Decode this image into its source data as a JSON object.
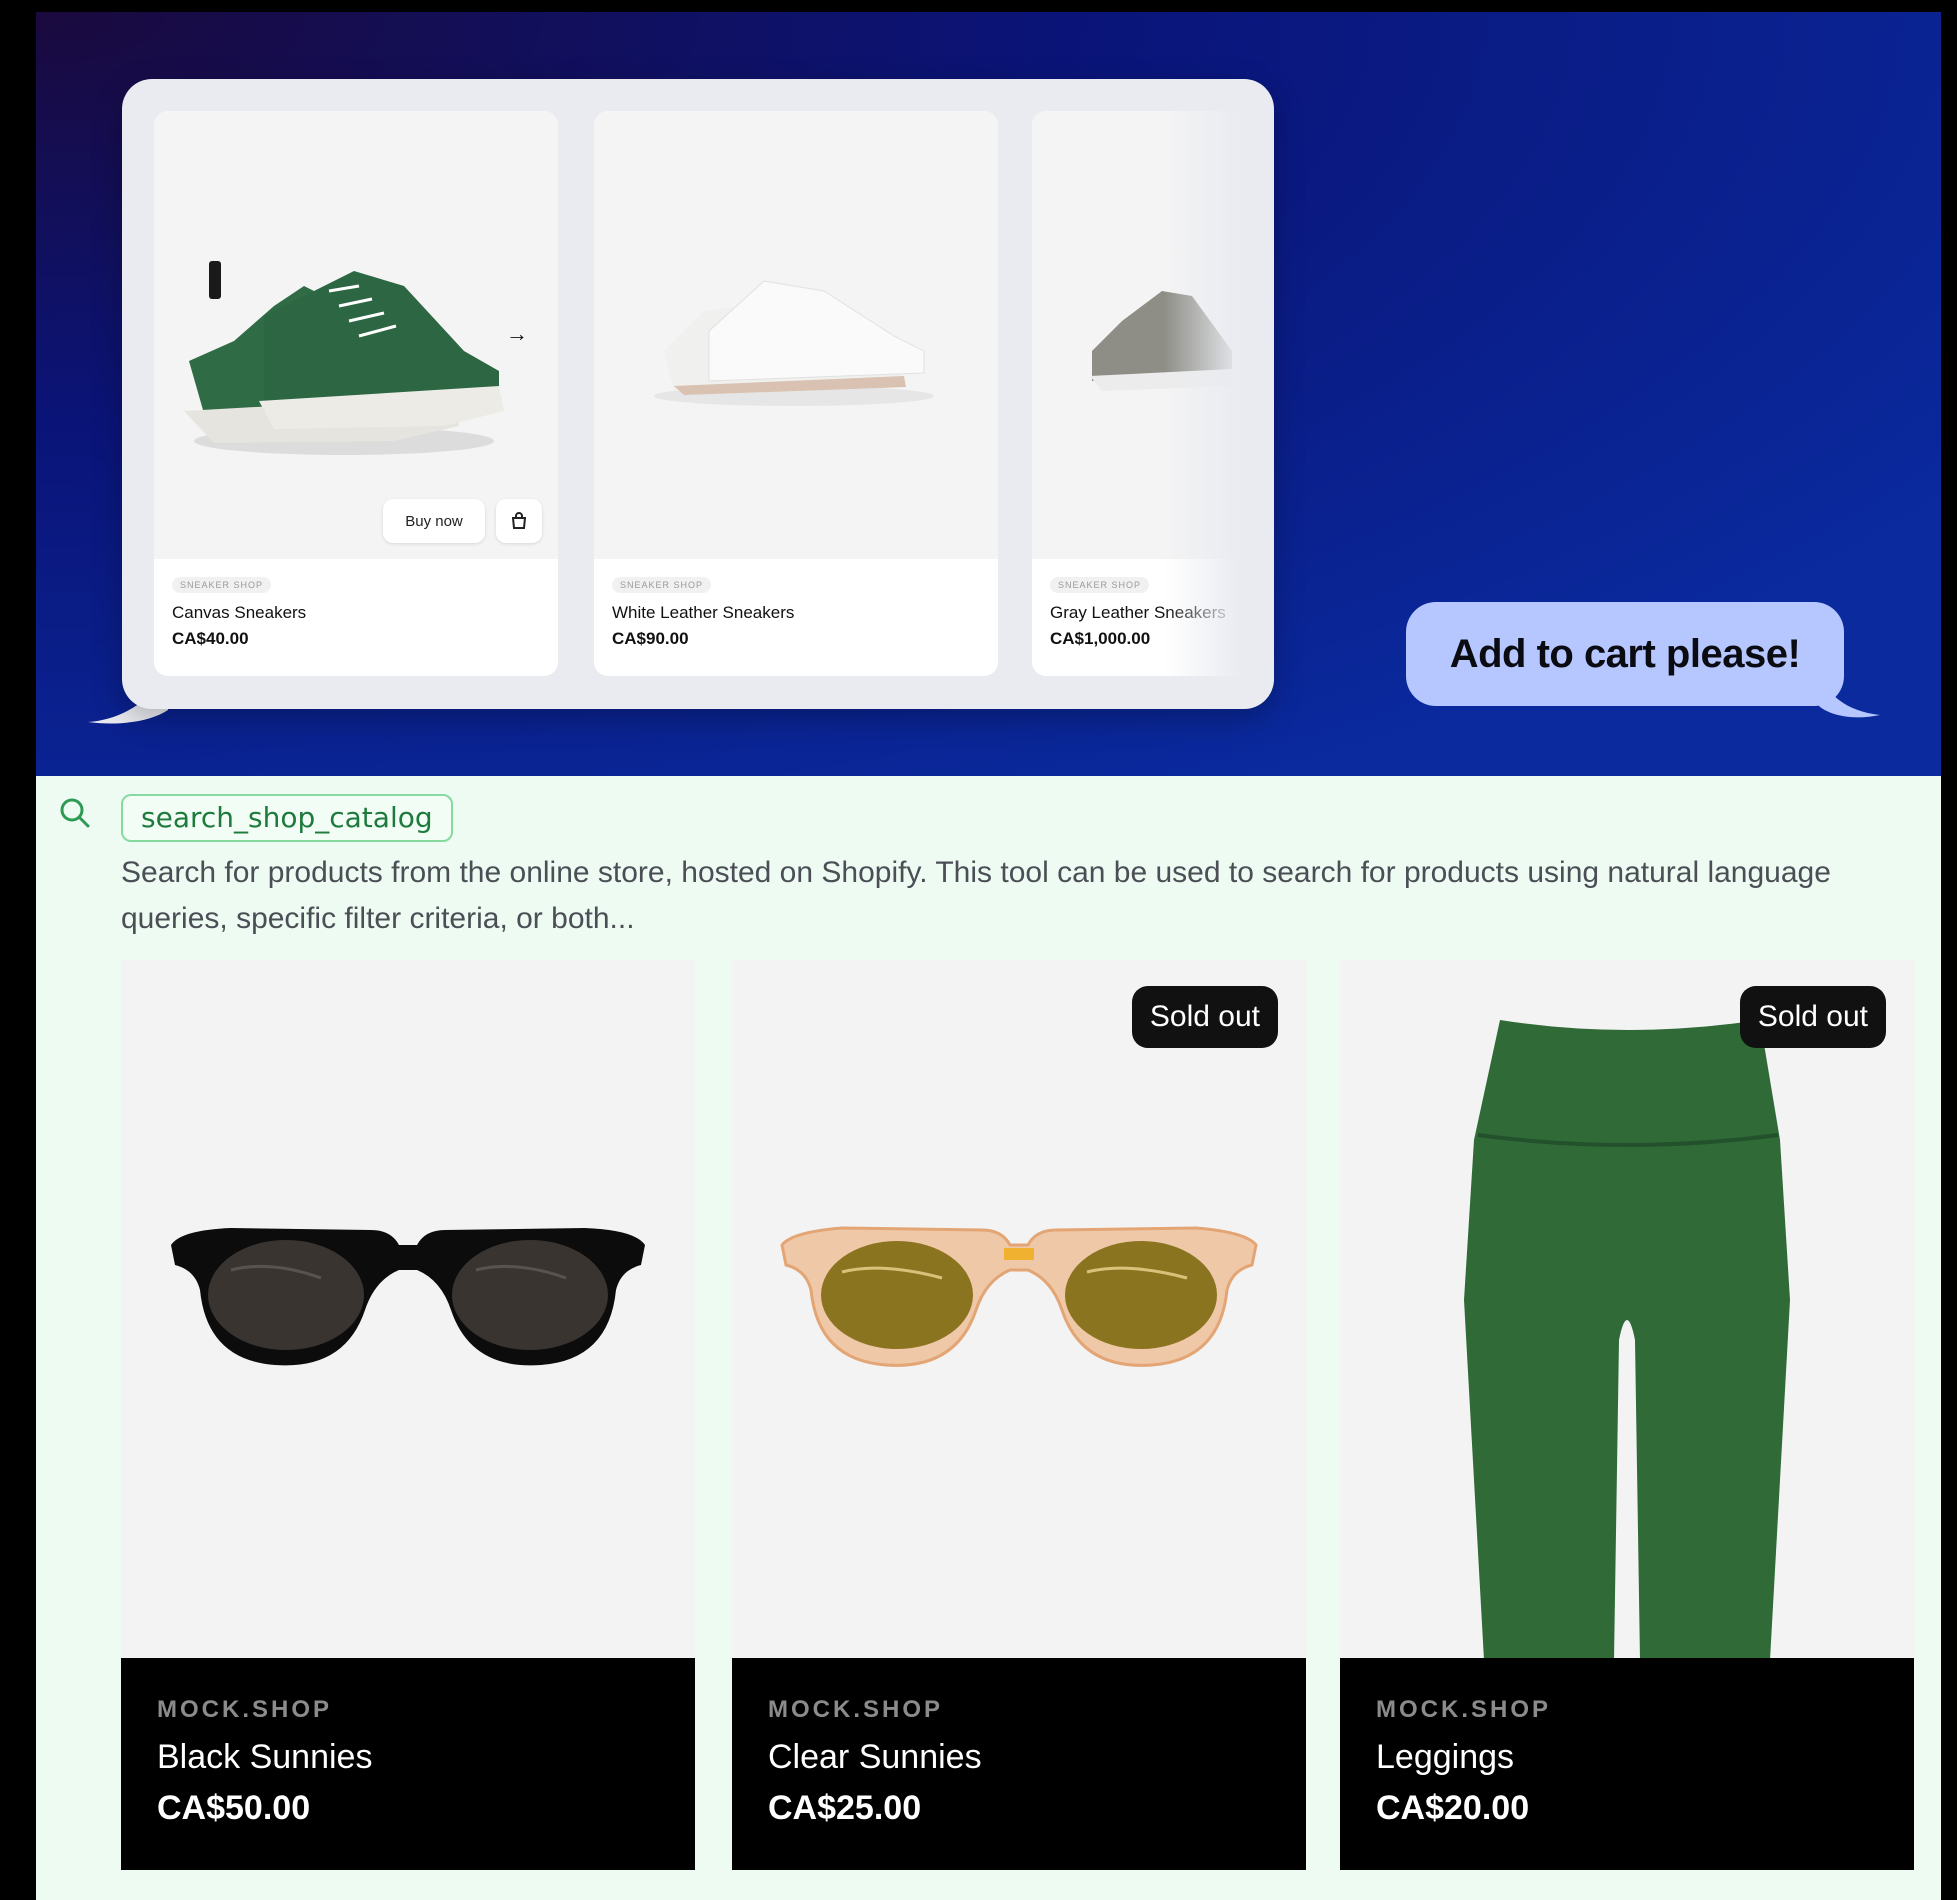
{
  "hero": {
    "cards": [
      {
        "tag": "Sneaker Shop",
        "title": "Canvas Sneakers",
        "price": "CA$40.00",
        "buy_label": "Buy now"
      },
      {
        "tag": "Sneaker Shop",
        "title": "White Leather Sneakers",
        "price": "CA$90.00"
      },
      {
        "tag": "Sneaker Shop",
        "title": "Gray Leather Sneakers",
        "price": "CA$1,000.00"
      }
    ],
    "bubble_text": "Add to cart please!"
  },
  "tool": {
    "name": "search_shop_catalog",
    "description": "Search for products from the online store, hosted on Shopify. This tool can be used to search for products using natural language queries, specific filter criteria, or both..."
  },
  "products": [
    {
      "vendor": "MOCK.SHOP",
      "name": "Black Sunnies",
      "price": "CA$50.00",
      "badge": ""
    },
    {
      "vendor": "MOCK.SHOP",
      "name": "Clear Sunnies",
      "price": "CA$25.00",
      "badge": "Sold out"
    },
    {
      "vendor": "MOCK.SHOP",
      "name": "Leggings",
      "price": "CA$20.00",
      "badge": "Sold out"
    }
  ],
  "colors": {
    "accent_green": "#1f7a3d",
    "bubble_blue": "#b6c7ff",
    "hero_bg": "#0a1478"
  }
}
